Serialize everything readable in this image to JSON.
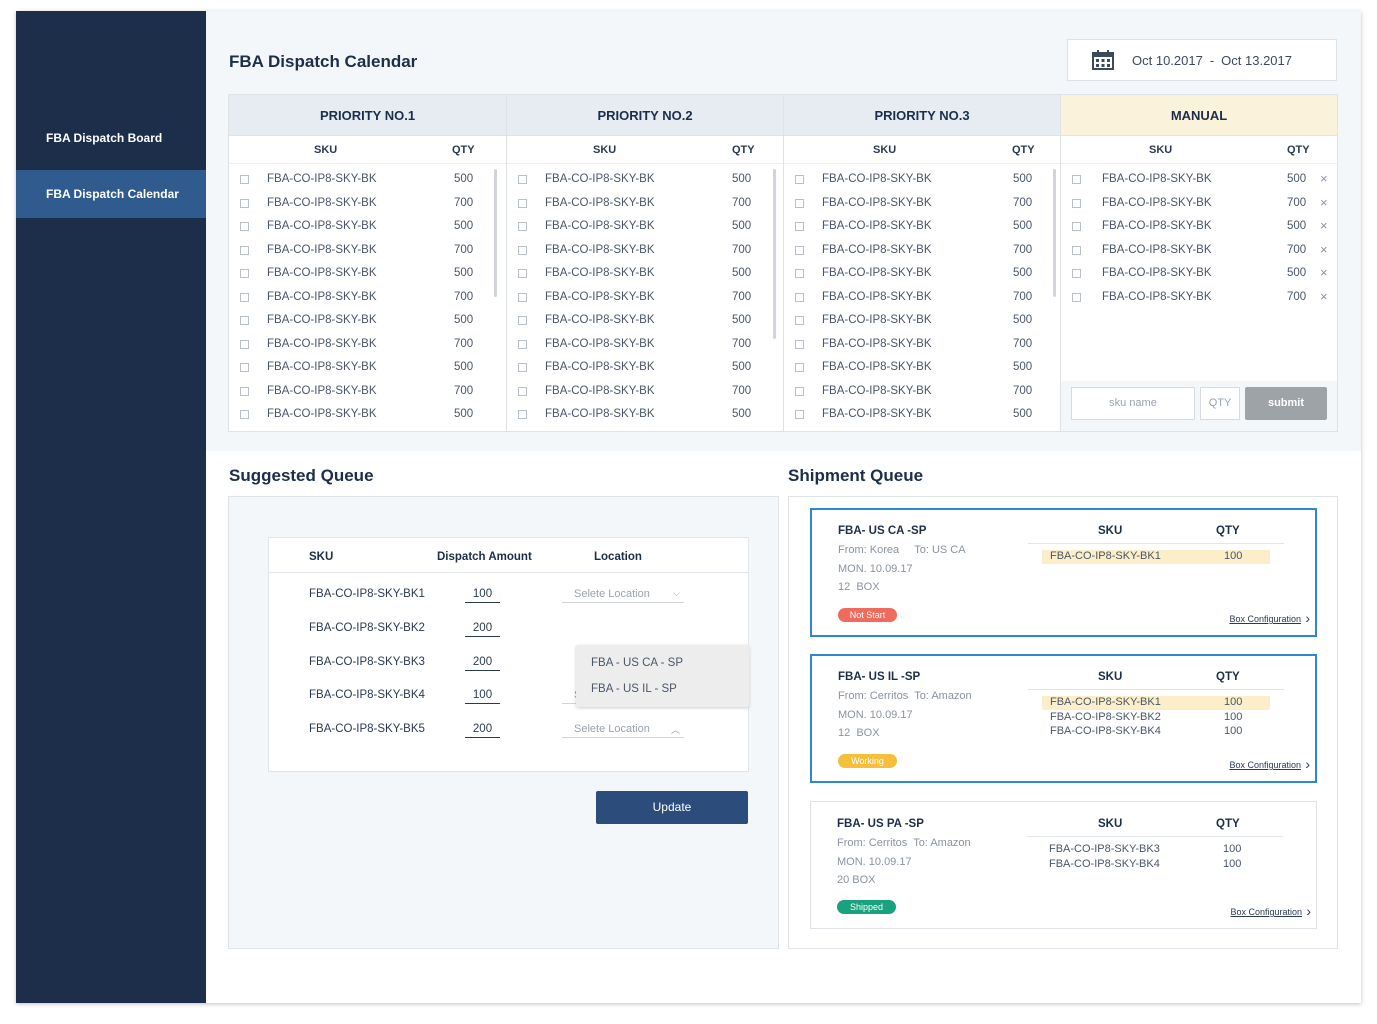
{
  "sidebar": {
    "items": [
      {
        "label": "FBA Dispatch Board",
        "active": false
      },
      {
        "label": "FBA Dispatch Calendar",
        "active": true
      }
    ]
  },
  "header": {
    "title": "FBA Dispatch Calendar",
    "date_range": {
      "start": "Oct 10.2017",
      "separator": "-",
      "end": "Oct 13.2017"
    },
    "date_icon": "calendar-icon"
  },
  "board": {
    "sku_header": "SKU",
    "qty_header": "QTY",
    "priority_rows": [
      {
        "sku": "FBA-CO-IP8-SKY-BK",
        "qty": "500"
      },
      {
        "sku": "FBA-CO-IP8-SKY-BK",
        "qty": "700"
      },
      {
        "sku": "FBA-CO-IP8-SKY-BK",
        "qty": "500"
      },
      {
        "sku": "FBA-CO-IP8-SKY-BK",
        "qty": "700"
      },
      {
        "sku": "FBA-CO-IP8-SKY-BK",
        "qty": "500"
      },
      {
        "sku": "FBA-CO-IP8-SKY-BK",
        "qty": "700"
      },
      {
        "sku": "FBA-CO-IP8-SKY-BK",
        "qty": "500"
      },
      {
        "sku": "FBA-CO-IP8-SKY-BK",
        "qty": "700"
      },
      {
        "sku": "FBA-CO-IP8-SKY-BK",
        "qty": "500"
      },
      {
        "sku": "FBA-CO-IP8-SKY-BK",
        "qty": "700"
      },
      {
        "sku": "FBA-CO-IP8-SKY-BK",
        "qty": "500"
      }
    ],
    "columns": [
      {
        "title": "PRIORITY NO.1"
      },
      {
        "title": "PRIORITY NO.2"
      },
      {
        "title": "PRIORITY NO.3"
      }
    ],
    "manual": {
      "title": "MANUAL",
      "rows": [
        {
          "sku": "FBA-CO-IP8-SKY-BK",
          "qty": "500"
        },
        {
          "sku": "FBA-CO-IP8-SKY-BK",
          "qty": "700"
        },
        {
          "sku": "FBA-CO-IP8-SKY-BK",
          "qty": "500"
        },
        {
          "sku": "FBA-CO-IP8-SKY-BK",
          "qty": "700"
        },
        {
          "sku": "FBA-CO-IP8-SKY-BK",
          "qty": "500"
        },
        {
          "sku": "FBA-CO-IP8-SKY-BK",
          "qty": "700"
        }
      ],
      "remove_glyph": "×",
      "sku_placeholder": "sku name",
      "qty_placeholder": "QTY",
      "submit_label": "submit"
    }
  },
  "suggested": {
    "title": "Suggested Queue",
    "headers": {
      "sku": "SKU",
      "amount": "Dispatch Amount",
      "location": "Location"
    },
    "rows": [
      {
        "sku": "FBA-CO-IP8-SKY-BK1",
        "amount": "100",
        "location": "Selete Location",
        "chevron": "⌵"
      },
      {
        "sku": "FBA-CO-IP8-SKY-BK2",
        "amount": "200",
        "location": "",
        "chevron": ""
      },
      {
        "sku": "FBA-CO-IP8-SKY-BK3",
        "amount": "200",
        "location": "",
        "chevron": ""
      },
      {
        "sku": "FBA-CO-IP8-SKY-BK4",
        "amount": "100",
        "location": "Selete Location",
        "chevron": "︿"
      },
      {
        "sku": "FBA-CO-IP8-SKY-BK5",
        "amount": "200",
        "location": "Selete Location",
        "chevron": "︿"
      }
    ],
    "dropdown_options": [
      "FBA - US CA - SP",
      "FBA - US IL - SP"
    ],
    "update_label": "Update"
  },
  "shipment": {
    "title": "Shipment Queue",
    "sku_header": "SKU",
    "qty_header": "QTY",
    "box_config_label": "Box Configuration",
    "cards": [
      {
        "name": "FBA- US CA -SP",
        "route": "From: Korea     To: US CA",
        "date": "MON. 10.09.17",
        "boxes": "12  BOX",
        "status": "Not Start",
        "status_color": "#ef6b5e",
        "selected": true,
        "items": [
          {
            "sku": "FBA-CO-IP8-SKY-BK1",
            "qty": "100",
            "highlight": true
          }
        ]
      },
      {
        "name": "FBA- US IL -SP",
        "route": "From: Cerritos  To: Amazon",
        "date": "MON. 10.09.17",
        "boxes": "12  BOX",
        "status": "Working",
        "status_color": "#f5bf3c",
        "selected": true,
        "items": [
          {
            "sku": "FBA-CO-IP8-SKY-BK1",
            "qty": "100",
            "highlight": true
          },
          {
            "sku": "FBA-CO-IP8-SKY-BK2",
            "qty": "100",
            "highlight": false
          },
          {
            "sku": "FBA-CO-IP8-SKY-BK4",
            "qty": "100",
            "highlight": false
          }
        ]
      },
      {
        "name": "FBA- US PA -SP",
        "route": "From: Cerritos  To: Amazon",
        "date": "MON. 10.09.17",
        "boxes": "20 BOX",
        "status": "Shipped",
        "status_color": "#1aa17f",
        "selected": false,
        "items": [
          {
            "sku": "FBA-CO-IP8-SKY-BK3",
            "qty": "100",
            "highlight": false
          },
          {
            "sku": "FBA-CO-IP8-SKY-BK4",
            "qty": "100",
            "highlight": false
          }
        ]
      }
    ]
  }
}
